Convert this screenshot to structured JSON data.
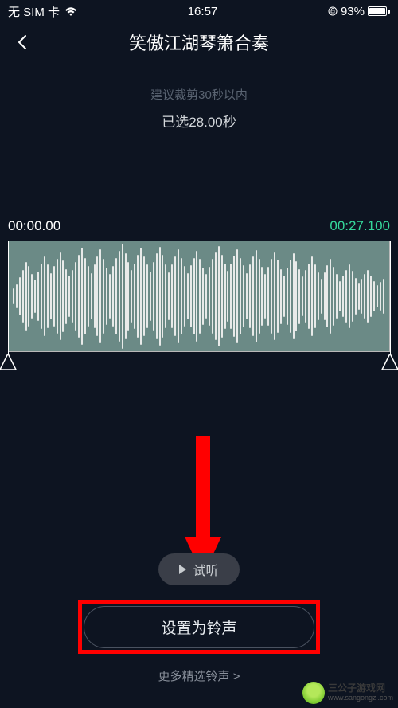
{
  "status": {
    "sim": "无 SIM 卡",
    "time": "16:57",
    "battery_pct": "93%"
  },
  "header": {
    "title": "笑傲江湖琴箫合奏"
  },
  "trim": {
    "hint": "建议裁剪30秒以内",
    "selected": "已选28.00秒",
    "start_time": "00:00.00",
    "end_time": "00:27.100"
  },
  "buttons": {
    "listen": "试听",
    "set_ringtone": "设置为铃声",
    "more": "更多精选铃声 >"
  },
  "watermark": {
    "name": "三公子游戏网",
    "url": "www.sangongzi.com"
  }
}
